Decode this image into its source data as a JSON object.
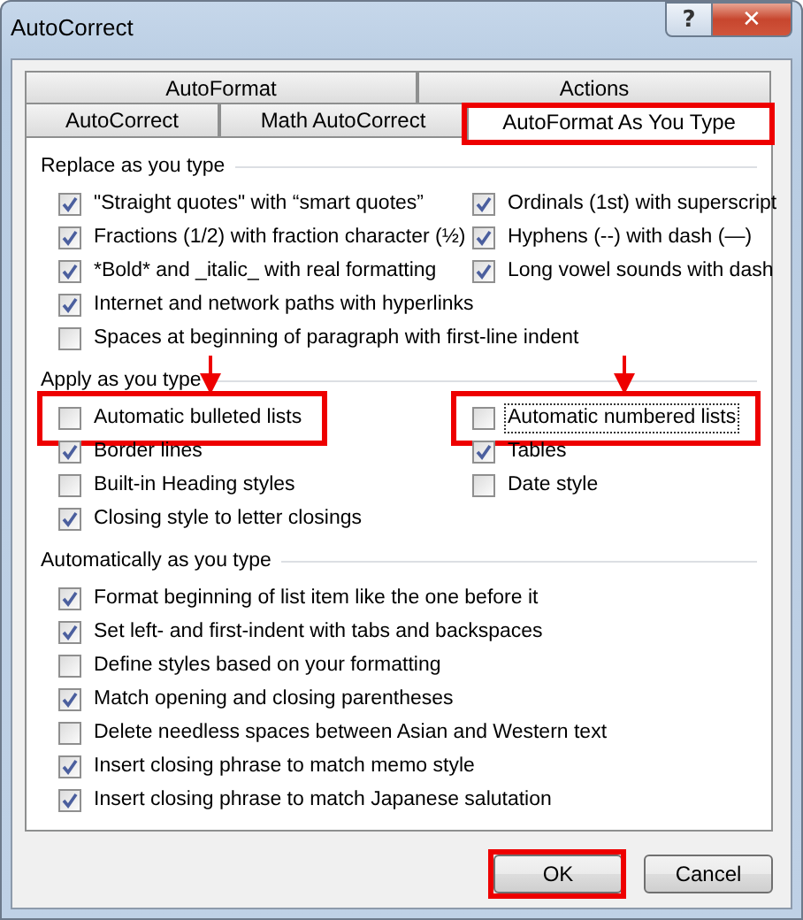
{
  "window": {
    "title": "AutoCorrect",
    "help_button": "?",
    "close_button": "✕"
  },
  "tab_rows": [
    [
      {
        "label": "AutoFormat",
        "selected": false,
        "highlighted": false
      },
      {
        "label": "Actions",
        "selected": false,
        "highlighted": false
      }
    ],
    [
      {
        "label": "AutoCorrect",
        "selected": false,
        "highlighted": false
      },
      {
        "label": "Math AutoCorrect",
        "selected": false,
        "highlighted": false
      },
      {
        "label": "AutoFormat As You Type",
        "selected": true,
        "highlighted": true
      }
    ]
  ],
  "sections": [
    {
      "title": "Replace as you type",
      "columns": [
        [
          {
            "label": "\"Straight quotes\" with “smart quotes”",
            "checked": true,
            "highlighted": false,
            "arrow": false,
            "focused": false
          },
          {
            "label": "Fractions (1/2) with fraction character (½)",
            "checked": true,
            "highlighted": false,
            "arrow": false,
            "focused": false
          },
          {
            "label": "*Bold* and _italic_ with real formatting",
            "checked": true,
            "highlighted": false,
            "arrow": false,
            "focused": false
          },
          {
            "label": "Internet and network paths with hyperlinks",
            "checked": true,
            "highlighted": false,
            "arrow": false,
            "focused": false
          },
          {
            "label": "Spaces at beginning of paragraph with first-line indent",
            "checked": false,
            "highlighted": false,
            "arrow": false,
            "focused": false
          }
        ],
        [
          {
            "label": "Ordinals (1st) with superscript",
            "checked": true,
            "highlighted": false,
            "arrow": false,
            "focused": false
          },
          {
            "label": "Hyphens (--) with dash (—)",
            "checked": true,
            "highlighted": false,
            "arrow": false,
            "focused": false
          },
          {
            "label": "Long vowel sounds with dash",
            "checked": true,
            "highlighted": false,
            "arrow": false,
            "focused": false
          }
        ]
      ]
    },
    {
      "title": "Apply as you type",
      "columns": [
        [
          {
            "label": "Automatic bulleted lists",
            "checked": false,
            "highlighted": true,
            "arrow": true,
            "focused": false
          },
          {
            "label": "Border lines",
            "checked": true,
            "highlighted": false,
            "arrow": false,
            "focused": false
          },
          {
            "label": "Built-in Heading styles",
            "checked": false,
            "highlighted": false,
            "arrow": false,
            "focused": false
          },
          {
            "label": "Closing style to letter closings",
            "checked": true,
            "highlighted": false,
            "arrow": false,
            "focused": false
          }
        ],
        [
          {
            "label": "Automatic numbered lists",
            "checked": false,
            "highlighted": true,
            "arrow": true,
            "focused": true
          },
          {
            "label": "Tables",
            "checked": true,
            "highlighted": false,
            "arrow": false,
            "focused": false
          },
          {
            "label": "Date style",
            "checked": false,
            "highlighted": false,
            "arrow": false,
            "focused": false
          }
        ]
      ]
    },
    {
      "title": "Automatically as you type",
      "columns": [
        [
          {
            "label": "Format beginning of list item like the one before it",
            "checked": true,
            "highlighted": false,
            "arrow": false,
            "focused": false
          },
          {
            "label": "Set left- and first-indent with tabs and backspaces",
            "checked": true,
            "highlighted": false,
            "arrow": false,
            "focused": false
          },
          {
            "label": "Define styles based on your formatting",
            "checked": false,
            "highlighted": false,
            "arrow": false,
            "focused": false
          },
          {
            "label": "Match opening and closing parentheses",
            "checked": true,
            "highlighted": false,
            "arrow": false,
            "focused": false
          },
          {
            "label": "Delete needless spaces between Asian and Western text",
            "checked": false,
            "highlighted": false,
            "arrow": false,
            "focused": false
          },
          {
            "label": "Insert closing phrase to match memo style",
            "checked": true,
            "highlighted": false,
            "arrow": false,
            "focused": false
          },
          {
            "label": "Insert closing phrase to match Japanese salutation",
            "checked": true,
            "highlighted": false,
            "arrow": false,
            "focused": false
          }
        ]
      ]
    }
  ],
  "buttons": [
    {
      "label": "OK",
      "highlighted": true
    },
    {
      "label": "Cancel",
      "highlighted": false
    }
  ]
}
